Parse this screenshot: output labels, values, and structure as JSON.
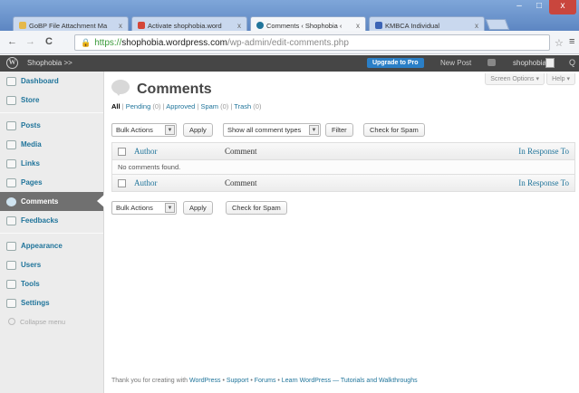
{
  "browser": {
    "tabs": [
      {
        "title": "GoBP File Attachment Ma",
        "icon_color": "#e5b84a",
        "active": false
      },
      {
        "title": "Activate shophobia.word",
        "icon_color": "#d44638",
        "active": false
      },
      {
        "title": "Comments ‹ Shophobia ‹",
        "icon_color": "#21759b",
        "active": true
      },
      {
        "title": "KMBCA Individual",
        "icon_color": "#3b63b5",
        "active": false
      }
    ],
    "url_scheme": "https://",
    "url_host": "shophobia.wordpress.com",
    "url_path": "/wp-admin/edit-comments.php",
    "back_glyph": "←",
    "forward_glyph": "→",
    "reload_glyph": "C",
    "star_glyph": "☆",
    "menu_glyph": "≡",
    "min_glyph": "–",
    "max_glyph": "□",
    "close_glyph": "x",
    "tab_close_glyph": "x"
  },
  "adminbar": {
    "logo_glyph": "W",
    "site_name": "Shophobia >>",
    "upgrade_label": "Upgrade to Pro",
    "new_post_label": "New Post",
    "user_name": "shophobia",
    "search_glyph": "Q"
  },
  "sidebar": {
    "groups": [
      [
        {
          "label": "Dashboard"
        },
        {
          "label": "Store"
        }
      ],
      [
        {
          "label": "Posts"
        },
        {
          "label": "Media"
        },
        {
          "label": "Links"
        },
        {
          "label": "Pages"
        },
        {
          "label": "Comments",
          "current": true
        },
        {
          "label": "Feedbacks"
        }
      ],
      [
        {
          "label": "Appearance"
        },
        {
          "label": "Users"
        },
        {
          "label": "Tools"
        },
        {
          "label": "Settings"
        }
      ]
    ],
    "collapse_label": "Collapse menu"
  },
  "main": {
    "screen_options_label": "Screen Options ▾",
    "help_label": "Help ▾",
    "page_title": "Comments",
    "filters": {
      "all": "All",
      "sep": " | ",
      "pending": "Pending",
      "pending_count": "(0)",
      "approved": "Approved",
      "spam": "Spam",
      "spam_count": "(0)",
      "trash": "Trash",
      "trash_count": "(0)"
    },
    "top_actions": {
      "bulk_select": "Bulk Actions",
      "apply": "Apply",
      "type_select": "Show all comment types",
      "filter": "Filter",
      "check_spam": "Check for Spam"
    },
    "table": {
      "col_author": "Author",
      "col_comment": "Comment",
      "col_response": "In Response To",
      "empty_message": "No comments found."
    },
    "bottom_actions": {
      "bulk_select": "Bulk Actions",
      "apply": "Apply",
      "check_spam": "Check for Spam"
    },
    "footer": {
      "intro": "Thank you for creating with ",
      "wordpress": "WordPress",
      "dot1": " • ",
      "support": "Support",
      "dot2": " • ",
      "forums": "Forums",
      "dot3": " • ",
      "learn": "Learn WordPress — Tutorials and Walkthroughs"
    }
  }
}
